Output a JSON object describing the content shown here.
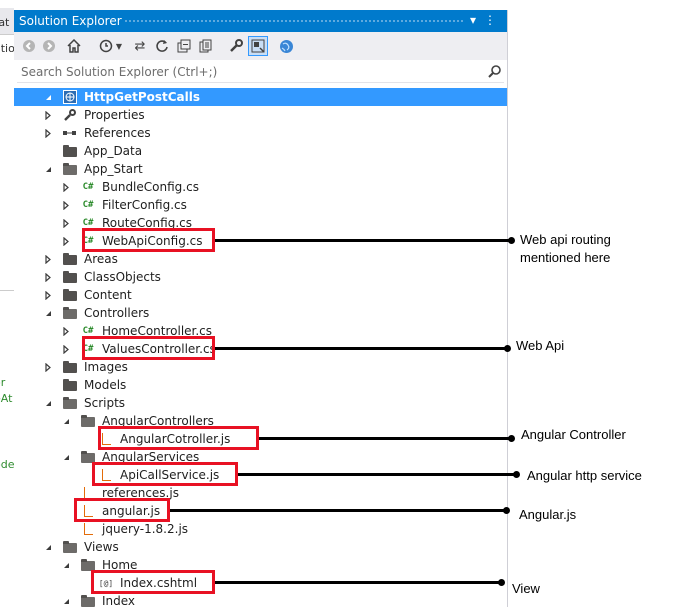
{
  "left_strip": {
    "fragments": [
      "tat",
      "atio",
      "or",
      "eAt",
      "ode"
    ]
  },
  "panel": {
    "title": "Solution Explorer",
    "title_icons": [
      "dropdown-arrow-icon",
      "pin-icon",
      "close-icon"
    ],
    "search_placeholder": "Search Solution Explorer (Ctrl+;)"
  },
  "toolbar": {
    "buttons": [
      "back-icon",
      "forward-icon",
      "home-icon",
      "history-icon",
      "dropdown-icon",
      "sync-icon",
      "refresh-icon",
      "collapse-all-icon",
      "show-all-files-icon",
      "properties-icon",
      "preview-icon",
      "globe-icon"
    ],
    "selected": "preview-icon"
  },
  "tree": [
    {
      "label": "HttpGetPostCalls",
      "icon": "web-project-icon",
      "level": 0,
      "expander": "expanded",
      "selected": true
    },
    {
      "label": "Properties",
      "icon": "wrench-icon",
      "level": 1,
      "expander": "collapsed"
    },
    {
      "label": "References",
      "icon": "references-icon",
      "level": 1,
      "expander": "collapsed"
    },
    {
      "label": "App_Data",
      "icon": "folder-icon",
      "level": 1,
      "expander": "none"
    },
    {
      "label": "App_Start",
      "icon": "folder-open-icon",
      "level": 1,
      "expander": "expanded"
    },
    {
      "label": "BundleConfig.cs",
      "icon": "csharp-file-icon",
      "level": 2,
      "expander": "collapsed"
    },
    {
      "label": "FilterConfig.cs",
      "icon": "csharp-file-icon",
      "level": 2,
      "expander": "collapsed"
    },
    {
      "label": "RouteConfig.cs",
      "icon": "csharp-file-icon",
      "level": 2,
      "expander": "collapsed"
    },
    {
      "label": "WebApiConfig.cs",
      "icon": "csharp-file-icon",
      "level": 2,
      "expander": "collapsed"
    },
    {
      "label": "Areas",
      "icon": "folder-icon",
      "level": 1,
      "expander": "collapsed"
    },
    {
      "label": "ClassObjects",
      "icon": "folder-icon",
      "level": 1,
      "expander": "collapsed"
    },
    {
      "label": "Content",
      "icon": "folder-icon",
      "level": 1,
      "expander": "collapsed"
    },
    {
      "label": "Controllers",
      "icon": "folder-open-icon",
      "level": 1,
      "expander": "expanded"
    },
    {
      "label": "HomeController.cs",
      "icon": "csharp-file-icon",
      "level": 2,
      "expander": "collapsed"
    },
    {
      "label": "ValuesController.cs",
      "icon": "csharp-file-icon",
      "level": 2,
      "expander": "collapsed"
    },
    {
      "label": "Images",
      "icon": "folder-icon",
      "level": 1,
      "expander": "collapsed"
    },
    {
      "label": "Models",
      "icon": "folder-icon",
      "level": 1,
      "expander": "none"
    },
    {
      "label": "Scripts",
      "icon": "folder-open-icon",
      "level": 1,
      "expander": "expanded"
    },
    {
      "label": "AngularControllers",
      "icon": "folder-open-icon",
      "level": 2,
      "expander": "expanded"
    },
    {
      "label": "AngularCotroller.js",
      "icon": "js-file-icon",
      "level": 3,
      "expander": "none"
    },
    {
      "label": "AngularServices",
      "icon": "folder-open-icon",
      "level": 2,
      "expander": "expanded"
    },
    {
      "label": "ApiCallService.js",
      "icon": "js-file-icon",
      "level": 3,
      "expander": "none"
    },
    {
      "label": "references.js",
      "icon": "js-file-icon",
      "level": 2,
      "expander": "none"
    },
    {
      "label": "angular.js",
      "icon": "js-file-icon",
      "level": 2,
      "expander": "none"
    },
    {
      "label": "jquery-1.8.2.js",
      "icon": "js-file-icon",
      "level": 2,
      "expander": "none"
    },
    {
      "label": "Views",
      "icon": "folder-open-icon",
      "level": 1,
      "expander": "expanded"
    },
    {
      "label": "Home",
      "icon": "folder-open-icon",
      "level": 2,
      "expander": "expanded"
    },
    {
      "label": "Index.cshtml",
      "icon": "razor-file-icon",
      "level": 3,
      "expander": "none"
    },
    {
      "label": "Index",
      "icon": "folder-open-icon",
      "level": 2,
      "expander": "expanded"
    }
  ],
  "annotations": [
    {
      "text": "Web api routing\nmentioned here",
      "target": "WebApiConfig.cs"
    },
    {
      "text": "Web Api",
      "target": "ValuesController.cs"
    },
    {
      "text": "Angular Controller",
      "target": "AngularCotroller.js"
    },
    {
      "text": "Angular http service",
      "target": "ApiCallService.js"
    },
    {
      "text": "Angular.js",
      "target": "angular.js"
    },
    {
      "text": "View",
      "target": "Index.cshtml"
    }
  ],
  "colors": {
    "titlebar": "#007acc",
    "selection": "#3399ff",
    "highlight_box": "#e81123",
    "arrow": "#000000"
  }
}
